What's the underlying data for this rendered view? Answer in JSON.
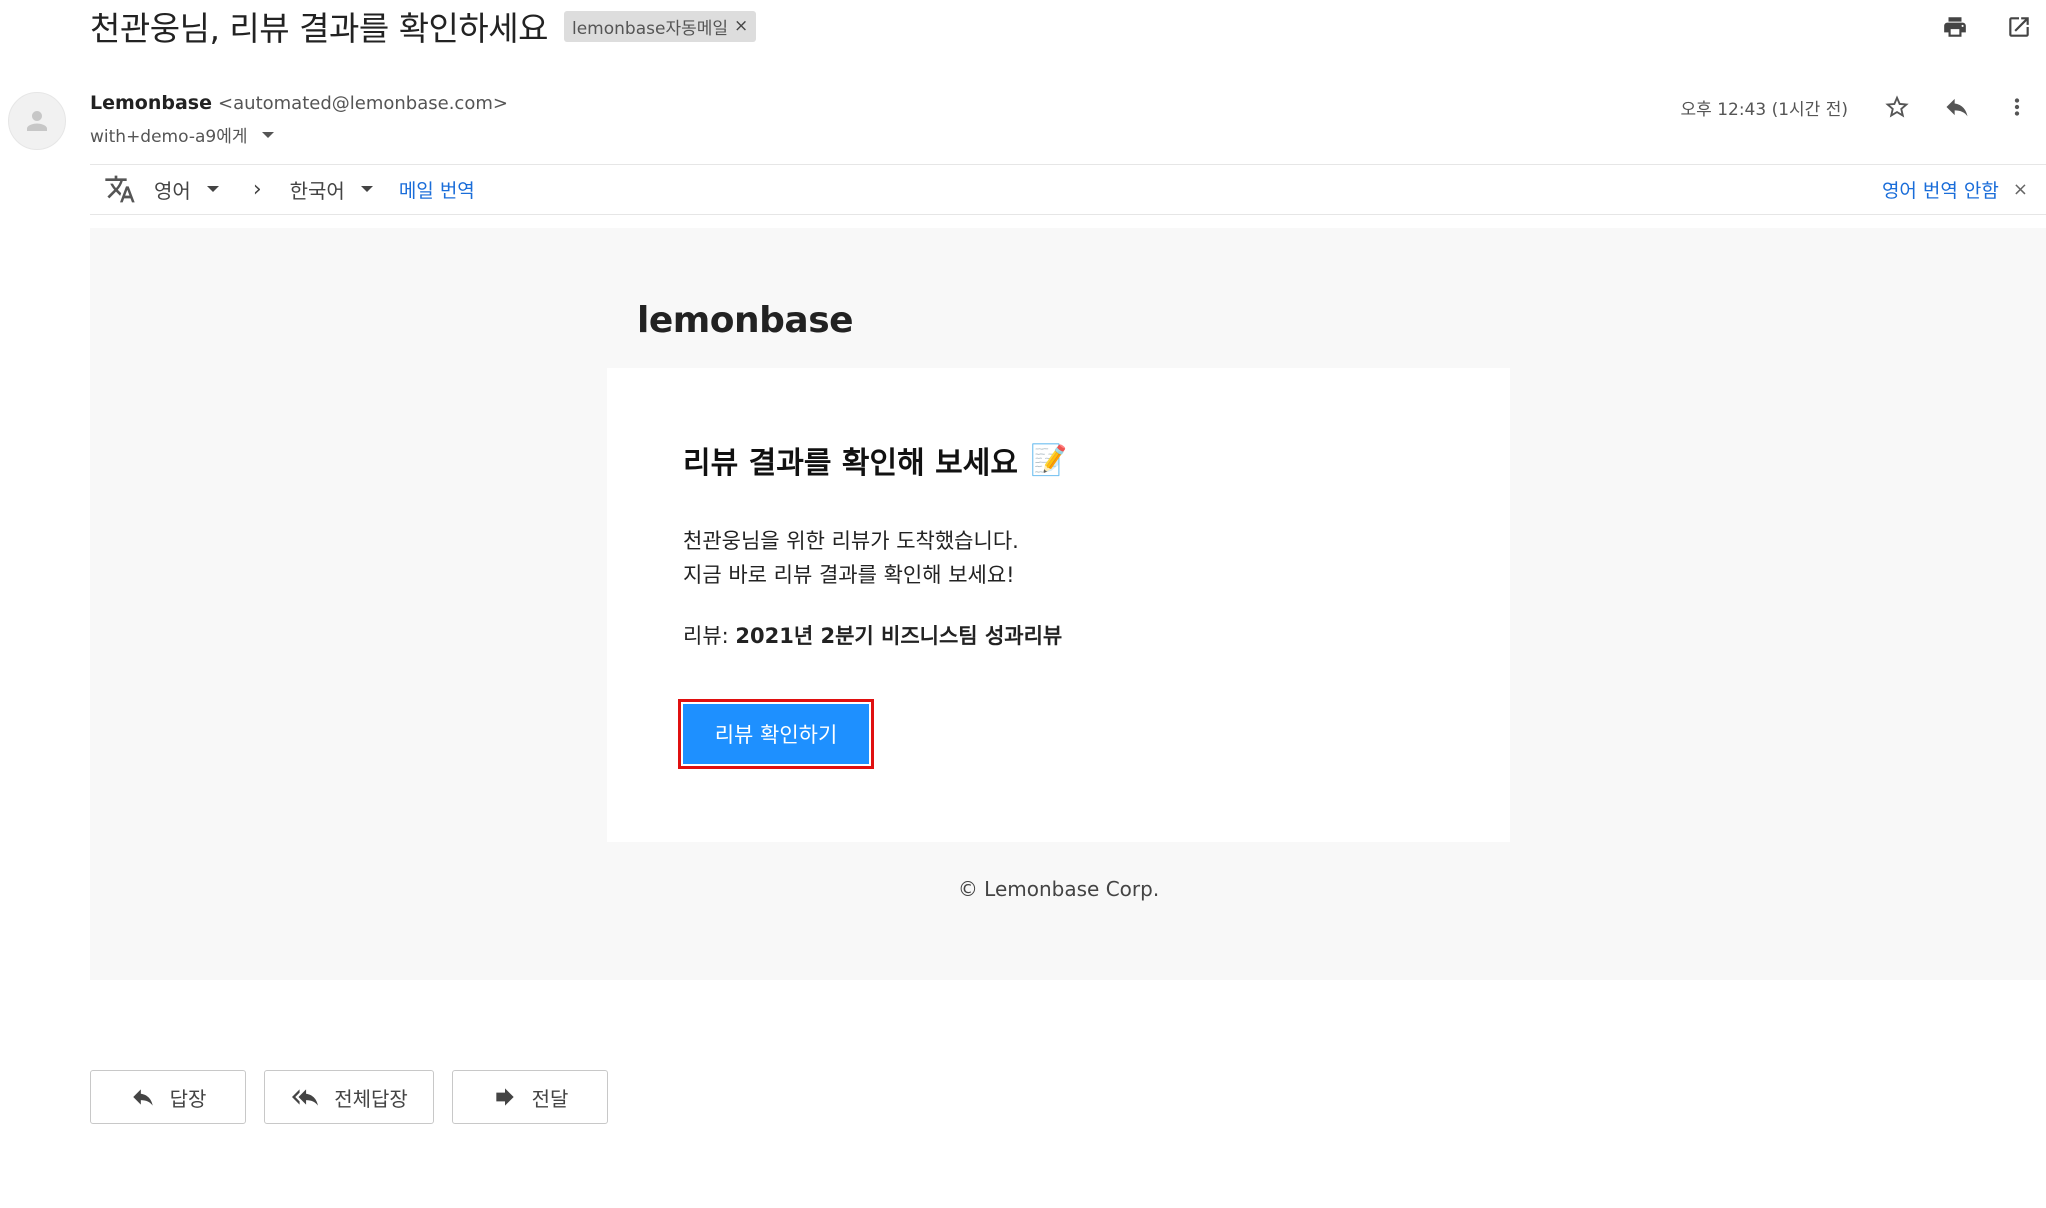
{
  "subject": {
    "title": "천관웅님, 리뷰 결과를 확인하세요",
    "label": "lemonbase자동메일",
    "label_remove": "×"
  },
  "header_icons": [
    "print-icon",
    "open-in-new-window-icon"
  ],
  "sender": {
    "name": "Lemonbase",
    "email": "<automated@lemonbase.com>",
    "recipient": "with+demo-a9에게"
  },
  "meta": {
    "timestamp": "오후 12:43 (1시간 전)",
    "icons": [
      "star-icon",
      "reply-icon",
      "more-vert-icon"
    ]
  },
  "translate_bar": {
    "source_lang": "영어",
    "arrow": "›",
    "target_lang": "한국어",
    "translate_message": "메일 번역",
    "dont_translate": "영어 번역 안함",
    "close": "×"
  },
  "email": {
    "brand": "lemonbase",
    "title": "리뷰 결과를 확인해 보세요",
    "title_emoji": "📝",
    "body_line1": "천관웅님을 위한 리뷰가 도착했습니다.",
    "body_line2": "지금 바로 리뷰 결과를 확인해 보세요!",
    "review_label": "리뷰: ",
    "review_name": "2021년 2분기 비즈니스팀 성과리뷰",
    "cta": "리뷰 확인하기",
    "copyright": "© Lemonbase Corp."
  },
  "actions": {
    "reply": "답장",
    "reply_all": "전체답장",
    "forward": "전달"
  },
  "colors": {
    "accent_blue": "#1e90ff",
    "link_blue": "#1a6dd9",
    "highlight_red": "#e01010"
  }
}
